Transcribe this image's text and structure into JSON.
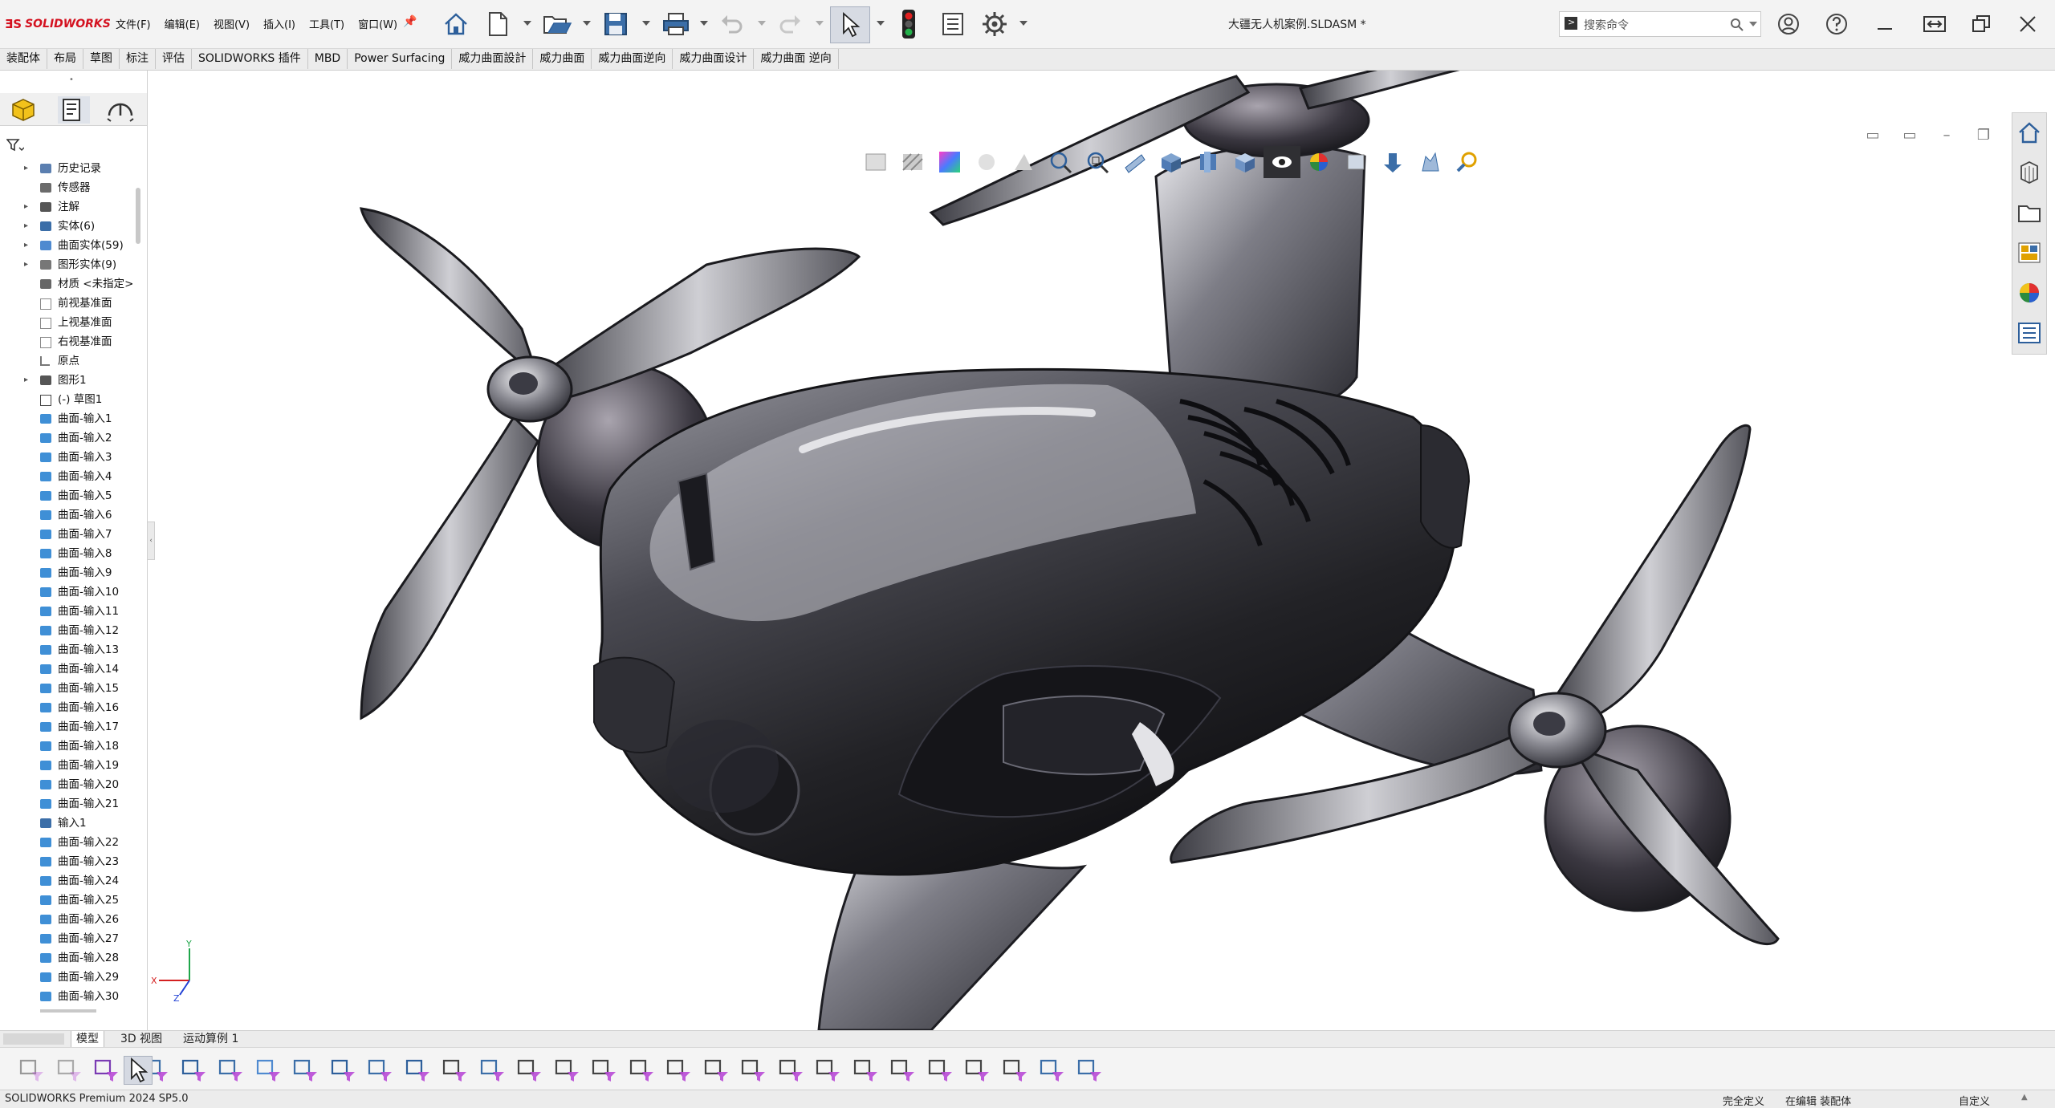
{
  "app": {
    "logo_text": "SOLIDWORKS",
    "document_title": "大疆无人机案例.SLDASM *"
  },
  "menu": [
    "文件(F)",
    "编辑(E)",
    "视图(V)",
    "插入(I)",
    "工具(T)",
    "窗口(W)"
  ],
  "search": {
    "placeholder": "搜索命令"
  },
  "command_tabs": [
    "装配体",
    "布局",
    "草图",
    "标注",
    "评估",
    "SOLIDWORKS 插件",
    "MBD",
    "Power Surfacing",
    "威力曲面設計",
    "威力曲面",
    "威力曲面逆向",
    "威力曲面设计",
    "威力曲面 逆向"
  ],
  "tree": [
    {
      "label": "历史记录",
      "icon": "history-icon",
      "expand": true
    },
    {
      "label": "传感器",
      "icon": "sensor-icon",
      "expand": false
    },
    {
      "label": "注解",
      "icon": "annotation-icon",
      "expand": true
    },
    {
      "label": "实体(6)",
      "icon": "solid-body-icon",
      "expand": true
    },
    {
      "label": "曲面实体(59)",
      "icon": "surface-body-icon",
      "expand": true
    },
    {
      "label": "图形实体(9)",
      "icon": "graphics-body-icon",
      "expand": true
    },
    {
      "label": "材质 <未指定>",
      "icon": "material-icon",
      "expand": false
    },
    {
      "label": "前视基准面",
      "icon": "plane-icon",
      "expand": false
    },
    {
      "label": "上视基准面",
      "icon": "plane-icon",
      "expand": false
    },
    {
      "label": "右视基准面",
      "icon": "plane-icon",
      "expand": false
    },
    {
      "label": "原点",
      "icon": "origin-icon",
      "expand": false
    },
    {
      "label": "图形1",
      "icon": "graphics-feature-icon",
      "expand": true
    },
    {
      "label": "(-) 草图1",
      "icon": "sketch-icon",
      "expand": false
    },
    {
      "label": "曲面-输入1",
      "icon": "surface-import-icon",
      "expand": false
    },
    {
      "label": "曲面-输入2",
      "icon": "surface-import-icon",
      "expand": false
    },
    {
      "label": "曲面-输入3",
      "icon": "surface-import-icon",
      "expand": false
    },
    {
      "label": "曲面-输入4",
      "icon": "surface-import-icon",
      "expand": false
    },
    {
      "label": "曲面-输入5",
      "icon": "surface-import-icon",
      "expand": false
    },
    {
      "label": "曲面-输入6",
      "icon": "surface-import-icon",
      "expand": false
    },
    {
      "label": "曲面-输入7",
      "icon": "surface-import-icon",
      "expand": false
    },
    {
      "label": "曲面-输入8",
      "icon": "surface-import-icon",
      "expand": false
    },
    {
      "label": "曲面-输入9",
      "icon": "surface-import-icon",
      "expand": false
    },
    {
      "label": "曲面-输入10",
      "icon": "surface-import-icon",
      "expand": false
    },
    {
      "label": "曲面-输入11",
      "icon": "surface-import-icon",
      "expand": false
    },
    {
      "label": "曲面-输入12",
      "icon": "surface-import-icon",
      "expand": false
    },
    {
      "label": "曲面-输入13",
      "icon": "surface-import-icon",
      "expand": false
    },
    {
      "label": "曲面-输入14",
      "icon": "surface-import-icon",
      "expand": false
    },
    {
      "label": "曲面-输入15",
      "icon": "surface-import-icon",
      "expand": false
    },
    {
      "label": "曲面-输入16",
      "icon": "surface-import-icon",
      "expand": false
    },
    {
      "label": "曲面-输入17",
      "icon": "surface-import-icon",
      "expand": false
    },
    {
      "label": "曲面-输入18",
      "icon": "surface-import-icon",
      "expand": false
    },
    {
      "label": "曲面-输入19",
      "icon": "surface-import-icon",
      "expand": false
    },
    {
      "label": "曲面-输入20",
      "icon": "surface-import-icon",
      "expand": false
    },
    {
      "label": "曲面-输入21",
      "icon": "surface-import-icon",
      "expand": false
    },
    {
      "label": "输入1",
      "icon": "solid-import-icon",
      "expand": false
    },
    {
      "label": "曲面-输入22",
      "icon": "surface-import-icon",
      "expand": false
    },
    {
      "label": "曲面-输入23",
      "icon": "surface-import-icon",
      "expand": false
    },
    {
      "label": "曲面-输入24",
      "icon": "surface-import-icon",
      "expand": false
    },
    {
      "label": "曲面-输入25",
      "icon": "surface-import-icon",
      "expand": false
    },
    {
      "label": "曲面-输入26",
      "icon": "surface-import-icon",
      "expand": false
    },
    {
      "label": "曲面-输入27",
      "icon": "surface-import-icon",
      "expand": false
    },
    {
      "label": "曲面-输入28",
      "icon": "surface-import-icon",
      "expand": false
    },
    {
      "label": "曲面-输入29",
      "icon": "surface-import-icon",
      "expand": false
    },
    {
      "label": "曲面-输入30",
      "icon": "surface-import-icon",
      "expand": false
    }
  ],
  "bottom_tabs": [
    "模型",
    "3D 视图",
    "运动算例 1"
  ],
  "status": {
    "product": "SOLIDWORKS Premium 2024 SP5.0",
    "definition": "完全定义",
    "editing": "在编辑 装配体",
    "custom": "自定义"
  },
  "triad": {
    "y": "Y",
    "x": "X",
    "z": "Z"
  },
  "colors": {
    "brand": "#d4111f",
    "model_dark": "#2a2a2e",
    "model_light": "#d8d8dc"
  }
}
